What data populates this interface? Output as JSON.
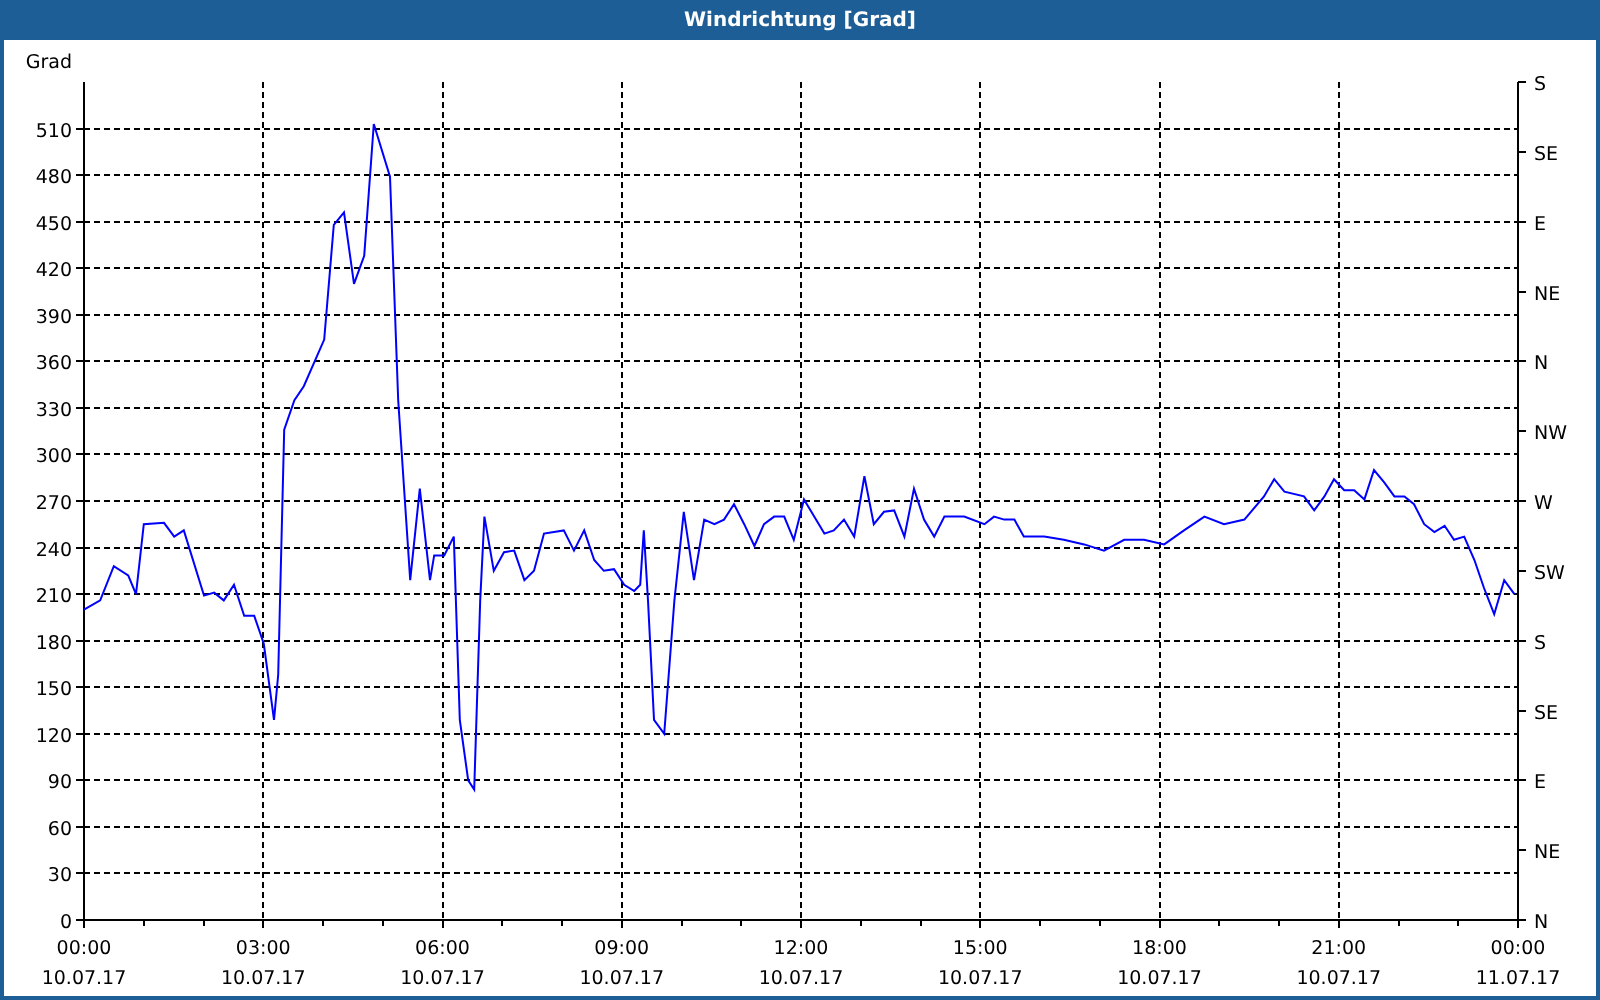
{
  "window": {
    "title": "Windrichtung [Grad]"
  },
  "chart": {
    "x_dates": [
      "10.07.17",
      "10.07.17",
      "10.07.17",
      "10.07.17",
      "10.07.17",
      "10.07.17",
      "10.07.17",
      "10.07.17",
      "11.07.17"
    ],
    "compass_labels": [
      "S",
      "SE",
      "E",
      "NE",
      "N",
      "NW",
      "W",
      "SW",
      "S",
      "SE",
      "E",
      "NE",
      "N"
    ],
    "chart_data": {
      "type": "line",
      "grid": true,
      "ylabel": "Grad",
      "xlim": [
        0,
        24
      ],
      "ylim": [
        0,
        540
      ],
      "xticks": [
        {
          "value": 0,
          "label": "00:00"
        },
        {
          "value": 3,
          "label": "03:00"
        },
        {
          "value": 6,
          "label": "06:00"
        },
        {
          "value": 9,
          "label": "09:00"
        },
        {
          "value": 12,
          "label": "12:00"
        },
        {
          "value": 15,
          "label": "15:00"
        },
        {
          "value": 18,
          "label": "18:00"
        },
        {
          "value": 21,
          "label": "21:00"
        },
        {
          "value": 24,
          "label": "00:00"
        }
      ],
      "yticks": [
        0,
        30,
        60,
        90,
        120,
        150,
        180,
        210,
        240,
        270,
        300,
        330,
        360,
        390,
        420,
        450,
        480,
        510
      ],
      "x": [
        0,
        0.27,
        0.5,
        0.74,
        0.87,
        1.0,
        1.34,
        1.51,
        1.67,
        2.01,
        2.18,
        2.34,
        2.51,
        2.68,
        2.85,
        3.01,
        3.18,
        3.25,
        3.35,
        3.52,
        3.68,
        4.02,
        4.18,
        4.35,
        4.52,
        4.69,
        4.85,
        5.12,
        5.26,
        5.46,
        5.62,
        5.79,
        5.86,
        6.03,
        6.19,
        6.29,
        6.43,
        6.53,
        6.63,
        6.7,
        6.86,
        7.03,
        7.2,
        7.37,
        7.53,
        7.7,
        8.03,
        8.2,
        8.37,
        8.54,
        8.7,
        8.87,
        9.04,
        9.21,
        9.31,
        9.37,
        9.44,
        9.54,
        9.71,
        9.88,
        10.04,
        10.21,
        10.38,
        10.55,
        10.71,
        10.88,
        11.05,
        11.22,
        11.38,
        11.55,
        11.72,
        11.88,
        12.05,
        12.22,
        12.39,
        12.55,
        12.72,
        12.89,
        13.06,
        13.22,
        13.39,
        13.56,
        13.73,
        13.89,
        14.06,
        14.23,
        14.4,
        14.73,
        15.07,
        15.23,
        15.4,
        15.57,
        15.73,
        16.07,
        16.4,
        16.74,
        17.07,
        17.41,
        17.74,
        18.08,
        18.41,
        18.75,
        19.08,
        19.42,
        19.75,
        19.92,
        20.09,
        20.42,
        20.59,
        20.76,
        20.92,
        21.09,
        21.26,
        21.43,
        21.59,
        21.76,
        21.93,
        22.1,
        22.26,
        22.43,
        22.6,
        22.77,
        22.93,
        23.1,
        23.27,
        23.43,
        23.6,
        23.77,
        23.94
      ],
      "series": [
        {
          "color": "#0000ff",
          "values": [
            200,
            206,
            228,
            222,
            210,
            255,
            256,
            247,
            251,
            209,
            211,
            206,
            216,
            196,
            196,
            178,
            129,
            158,
            316,
            335,
            344,
            374,
            448,
            456,
            410,
            428,
            513,
            479,
            335,
            219,
            278,
            219,
            235,
            235,
            247,
            129,
            90,
            84,
            206,
            260,
            225,
            237,
            238,
            219,
            225,
            249,
            251,
            238,
            251,
            232,
            225,
            226,
            216,
            212,
            216,
            251,
            206,
            129,
            120,
            206,
            263,
            219,
            258,
            255,
            258,
            268,
            255,
            241,
            255,
            260,
            260,
            245,
            271,
            260,
            249,
            251,
            258,
            247,
            286,
            255,
            263,
            264,
            247,
            278,
            258,
            247,
            260,
            260,
            255,
            260,
            258,
            258,
            247,
            247,
            245,
            242,
            238,
            245,
            245,
            242,
            251,
            260,
            255,
            258,
            273,
            284,
            276,
            273,
            264,
            273,
            284,
            277,
            277,
            271,
            290,
            282,
            273,
            273,
            268,
            255,
            250,
            254,
            245,
            247,
            232,
            214,
            197,
            219,
            210
          ]
        }
      ]
    }
  }
}
